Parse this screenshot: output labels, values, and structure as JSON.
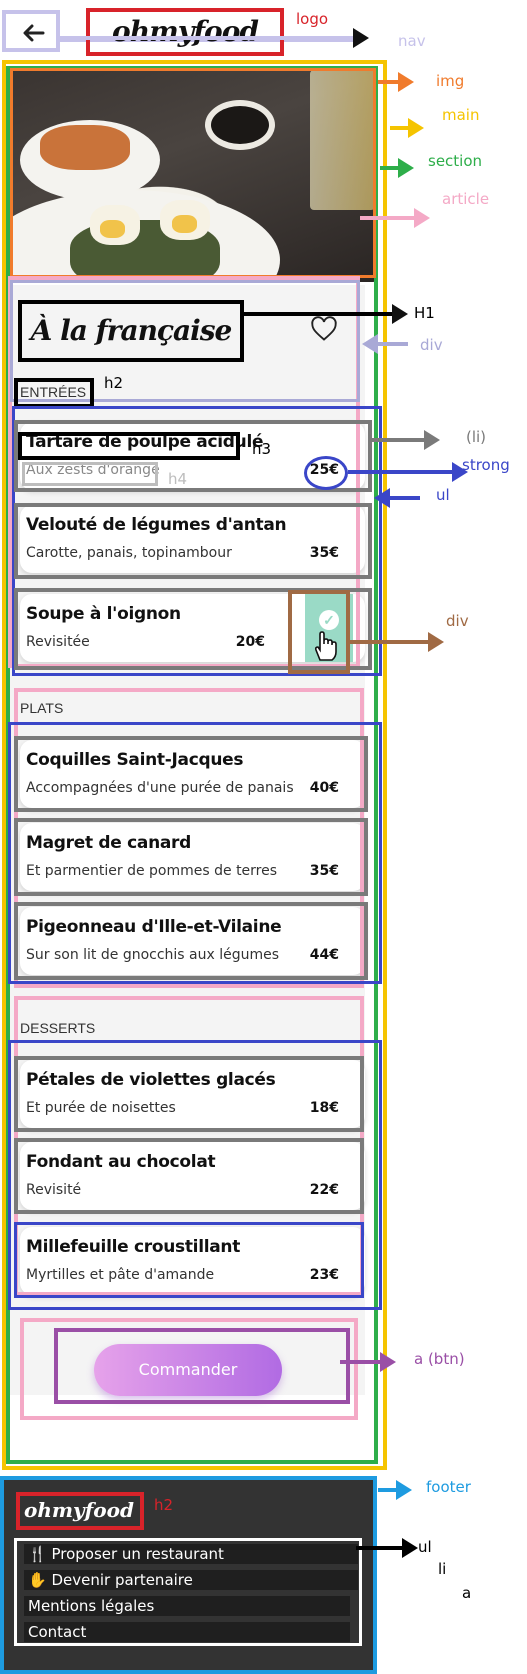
{
  "header": {
    "logo_text": "ohmyfood"
  },
  "menu": {
    "title": "À la française",
    "sections": [
      {
        "heading": "ENTRÉES",
        "dishes": [
          {
            "name": "Tartare de poulpe acidulé",
            "desc": "Aux zests d'orange",
            "price": "25€"
          },
          {
            "name": "Velouté de légumes d'antan",
            "desc": "Carotte, panais, topinambour",
            "price": "35€"
          },
          {
            "name": "Soupe à l'oignon",
            "desc": "Revisitée",
            "price": "20€"
          }
        ]
      },
      {
        "heading": "PLATS",
        "dishes": [
          {
            "name": "Coquilles Saint-Jacques",
            "desc": "Accompagnées d'une purée de panais",
            "price": "40€"
          },
          {
            "name": "Magret de canard",
            "desc": "Et parmentier de pommes de terres",
            "price": "35€"
          },
          {
            "name": "Pigeonneau d'Ille-et-Vilaine",
            "desc": "Sur son lit de gnocchis aux légumes",
            "price": "44€"
          }
        ]
      },
      {
        "heading": "DESSERTS",
        "dishes": [
          {
            "name": "Pétales de violettes glacés",
            "desc": "Et purée de noisettes",
            "price": "18€"
          },
          {
            "name": "Fondant au chocolat",
            "desc": "Revisité",
            "price": "22€"
          },
          {
            "name": "Millefeuille croustillant",
            "desc": "Myrtilles et pâte d'amande",
            "price": "23€"
          }
        ]
      }
    ],
    "order_button": "Commander"
  },
  "footer": {
    "logo_text": "ohmyfood",
    "links": [
      "Proposer un restaurant",
      "Devenir partenaire",
      "Mentions légales",
      "Contact"
    ]
  },
  "annotations": {
    "logo": "logo",
    "nav": "nav",
    "img": "img",
    "main": "main",
    "section": "section",
    "article": "article",
    "h1": "H1",
    "div_top": "div",
    "h2": "h2",
    "li": "(li)",
    "h3": "h3",
    "strong": "strong",
    "h4": "h4",
    "ul": "ul",
    "div_check": "div",
    "a_btn": "a (btn)",
    "footer": "footer",
    "footer_h2": "h2",
    "footer_ul": "ul",
    "footer_li": "li",
    "footer_a": "a"
  },
  "colors": {
    "logo": "#d8232a",
    "nav": "#c6c2ea",
    "img": "#f07b2c",
    "main": "#f5c400",
    "section": "#2eae4a",
    "article": "#f4a9c6",
    "div": "#a9a9d6",
    "li": "#7a7a7a",
    "strong": "#3a46c8",
    "ul": "#3a46c8",
    "h4": "#bdbdbd",
    "div_check": "#a06a44",
    "a_btn": "#9a4fa6",
    "footer": "#1e9be0",
    "black": "#000000"
  }
}
